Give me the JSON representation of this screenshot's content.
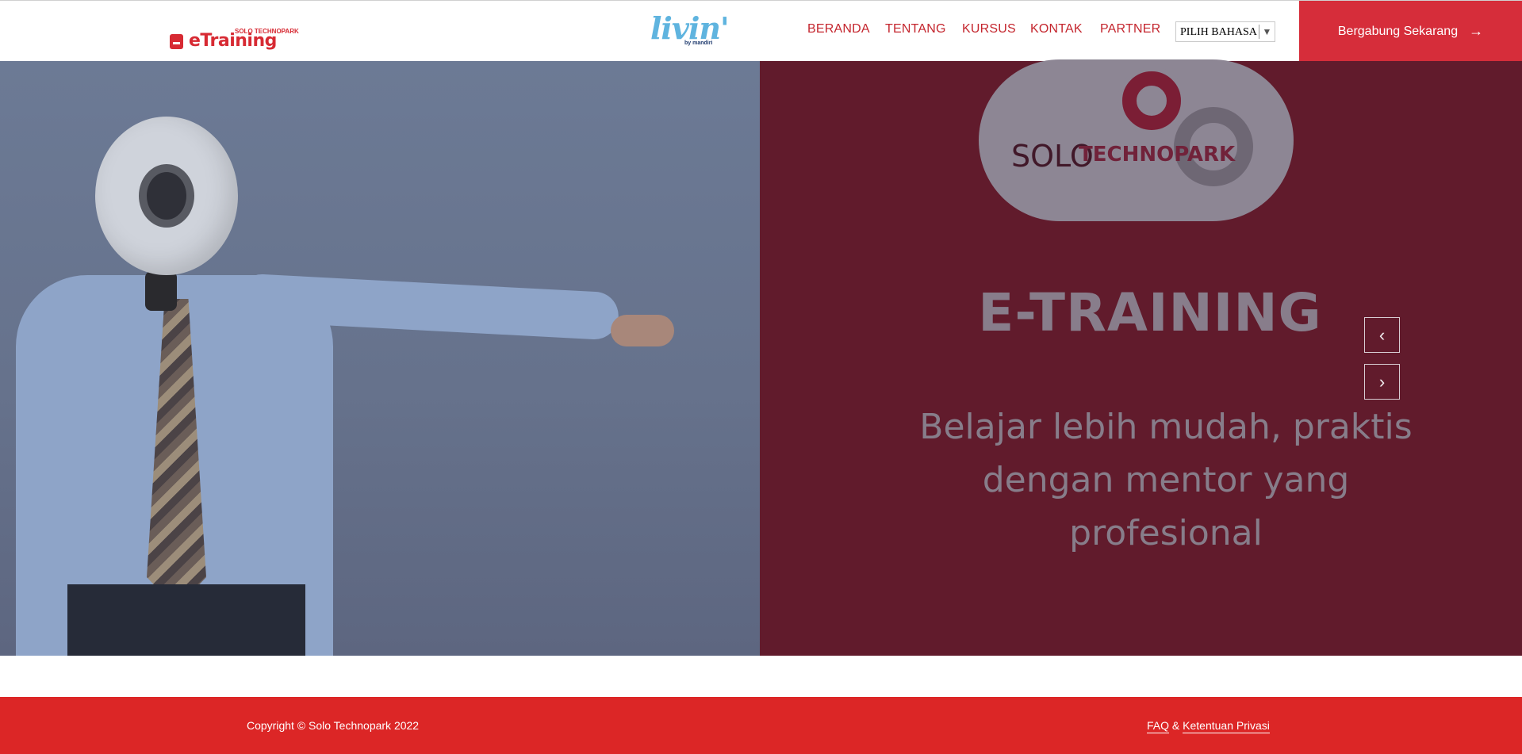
{
  "header": {
    "logo_text": "eTraining",
    "logo_brand": "SOLO TECHNOPARK",
    "partner_logo": "livin'",
    "partner_logo_by": "by mandiri",
    "nav": [
      "BERANDA",
      "TENTANG",
      "KURSUS",
      "KONTAK",
      "PARTNER"
    ],
    "language_select": "PILIH BAHASA",
    "cta_label": "Bergabung Sekarang"
  },
  "hero": {
    "brand_solo": "SOLO",
    "brand_technopark": "TECHNOPARK",
    "title": "E-TRAINING",
    "subtitle": "Belajar lebih mudah, praktis dengan mentor yang profesional",
    "prev_icon": "chevron-left-icon",
    "next_icon": "chevron-right-icon"
  },
  "footer": {
    "copyright": "Copyright © Solo Technopark 2022",
    "faq": "FAQ",
    "amp": "&",
    "privacy": "Ketentuan Privasi"
  },
  "colors": {
    "primary_red": "#d62d3a",
    "footer_red": "#dc2626",
    "hero_dark": "#611b2c",
    "nav_text": "#c4262e"
  }
}
